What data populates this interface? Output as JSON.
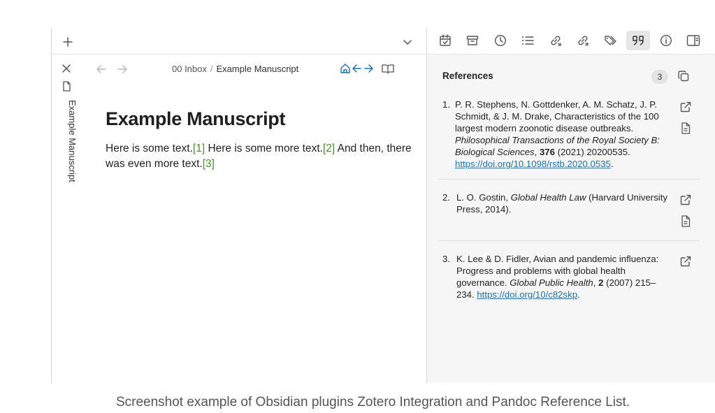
{
  "left_pane": {
    "vertical_tab_label": "Example Manuscript",
    "breadcrumb": {
      "folder": "00 Inbox",
      "separator": "/",
      "file": "Example Manuscript"
    }
  },
  "document": {
    "title": "Example Manuscript",
    "body": [
      {
        "text": "Here is some text.",
        "cite": "[1]"
      },
      {
        "text": " Here is some more text.",
        "cite": "[2]"
      },
      {
        "text": " And then, there was even more text.",
        "cite": "[3]"
      }
    ]
  },
  "references": {
    "header": "References",
    "count": "3",
    "items": [
      {
        "num": "1.",
        "authors": "P. R. Stephens, N. Gottdenker, A. M. Schatz, J. P. Schmidt, & J. M. Drake, Characteristics of the 100 largest modern zoonotic disease outbreaks.",
        "journal": "Philosophical Transactions of the Royal Society B: Biological Sciences",
        "comma": ", ",
        "volume": "376",
        "details": " (2021) 20200535.",
        "link": "https://doi.org/10.1098/rstb.2020.0535",
        "end": "."
      },
      {
        "num": "2.",
        "pre": "L. O. Gostin, ",
        "title_italic": "Global Health Law",
        "post": " (Harvard University Press, 2014)."
      },
      {
        "num": "3.",
        "authors": "K. Lee & D. Fidler, Avian and pandemic influenza: Progress and problems with global health governance.",
        "journal": "Global Public Health",
        "comma": ", ",
        "volume": "2",
        "details": " (2007) 215–234.",
        "link": "https://doi.org/10/c82skp",
        "end": "."
      }
    ]
  },
  "caption": "Screenshot example of Obsidian plugins Zotero Integration and Pandoc Reference List.",
  "icons": {
    "new_tab": "plus-icon",
    "tab_list": "chevron-down-icon",
    "close": "close-icon",
    "file": "file-icon",
    "back": "arrow-left-icon",
    "forward": "arrow-right-icon",
    "reading_view": "book-open-icon",
    "more": "more-vertical-icon",
    "toolbar": [
      "calendar-check-icon",
      "archive-icon",
      "clock-icon",
      "list-icon",
      "link-in-icon",
      "link-out-icon",
      "tags-icon",
      "quote-icon",
      "info-icon",
      "sidebar-right-icon"
    ]
  },
  "colors": {
    "citation": "#4f8a2d",
    "link": "#1f6fa0",
    "sidebar_bg": "#f6f6f6"
  }
}
